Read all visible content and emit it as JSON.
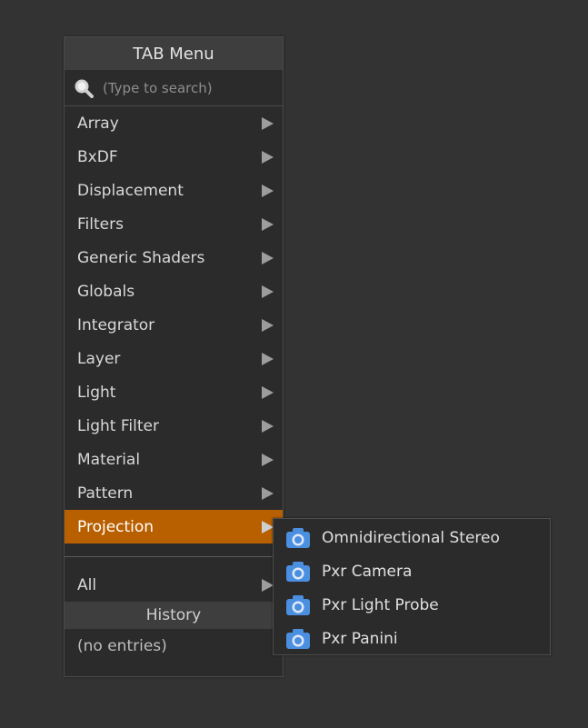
{
  "menu": {
    "title": "TAB Menu",
    "search_placeholder": "(Type to search)",
    "items": [
      {
        "label": "Array"
      },
      {
        "label": "BxDF"
      },
      {
        "label": "Displacement"
      },
      {
        "label": "Filters"
      },
      {
        "label": "Generic Shaders"
      },
      {
        "label": "Globals"
      },
      {
        "label": "Integrator"
      },
      {
        "label": "Layer"
      },
      {
        "label": "Light"
      },
      {
        "label": "Light Filter"
      },
      {
        "label": "Material"
      },
      {
        "label": "Pattern"
      },
      {
        "label": "Projection"
      }
    ],
    "selected_item": "Projection",
    "all_label": "All",
    "history_header": "History",
    "history_empty": "(no entries)"
  },
  "submenu": {
    "items": [
      {
        "label": "Omnidirectional Stereo",
        "icon": "camera-icon"
      },
      {
        "label": "Pxr Camera",
        "icon": "camera-icon"
      },
      {
        "label": "Pxr Light Probe",
        "icon": "camera-icon"
      },
      {
        "label": "Pxr Panini",
        "icon": "camera-icon"
      }
    ]
  },
  "colors": {
    "background": "#333333",
    "menu_background": "#2b2b2b",
    "header_background": "#3e3e3e",
    "selected_background": "#b85f00",
    "icon_blue": "#4b8fe0"
  }
}
